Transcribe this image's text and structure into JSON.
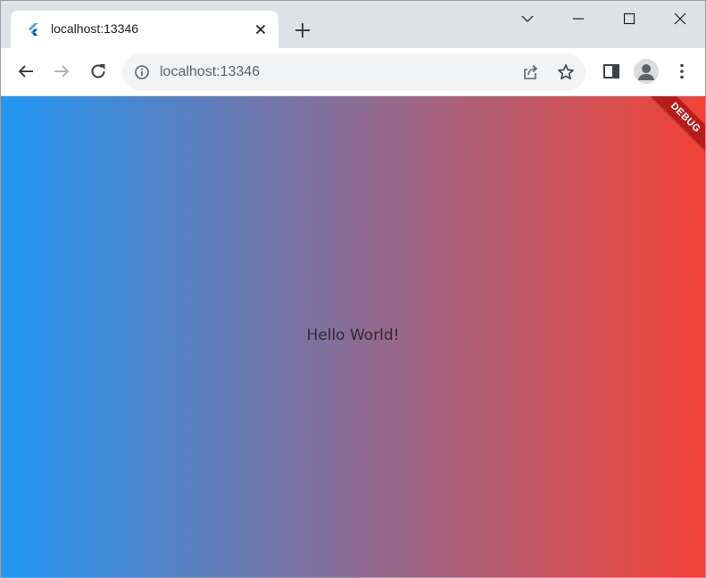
{
  "browser": {
    "tab": {
      "title": "localhost:13346",
      "favicon": "flutter-icon"
    },
    "new_tab_icon": "plus-icon",
    "window_controls": [
      "chevron-down-icon",
      "minimize-icon",
      "maximize-icon",
      "close-icon"
    ],
    "toolbar": {
      "back_icon": "arrow-left-icon",
      "forward_icon": "arrow-right-icon",
      "reload_icon": "reload-icon",
      "url": "localhost:13346",
      "site_info_icon": "info-icon",
      "share_icon": "share-icon",
      "bookmark_icon": "star-icon",
      "side_panel_icon": "side-panel-icon",
      "profile_icon": "avatar-icon",
      "menu_icon": "kebab-menu-icon"
    }
  },
  "app": {
    "message": "Hello World!",
    "debug_banner": "DEBUG",
    "gradient": {
      "start_color": "#2196f3",
      "end_color": "#f44336"
    }
  }
}
